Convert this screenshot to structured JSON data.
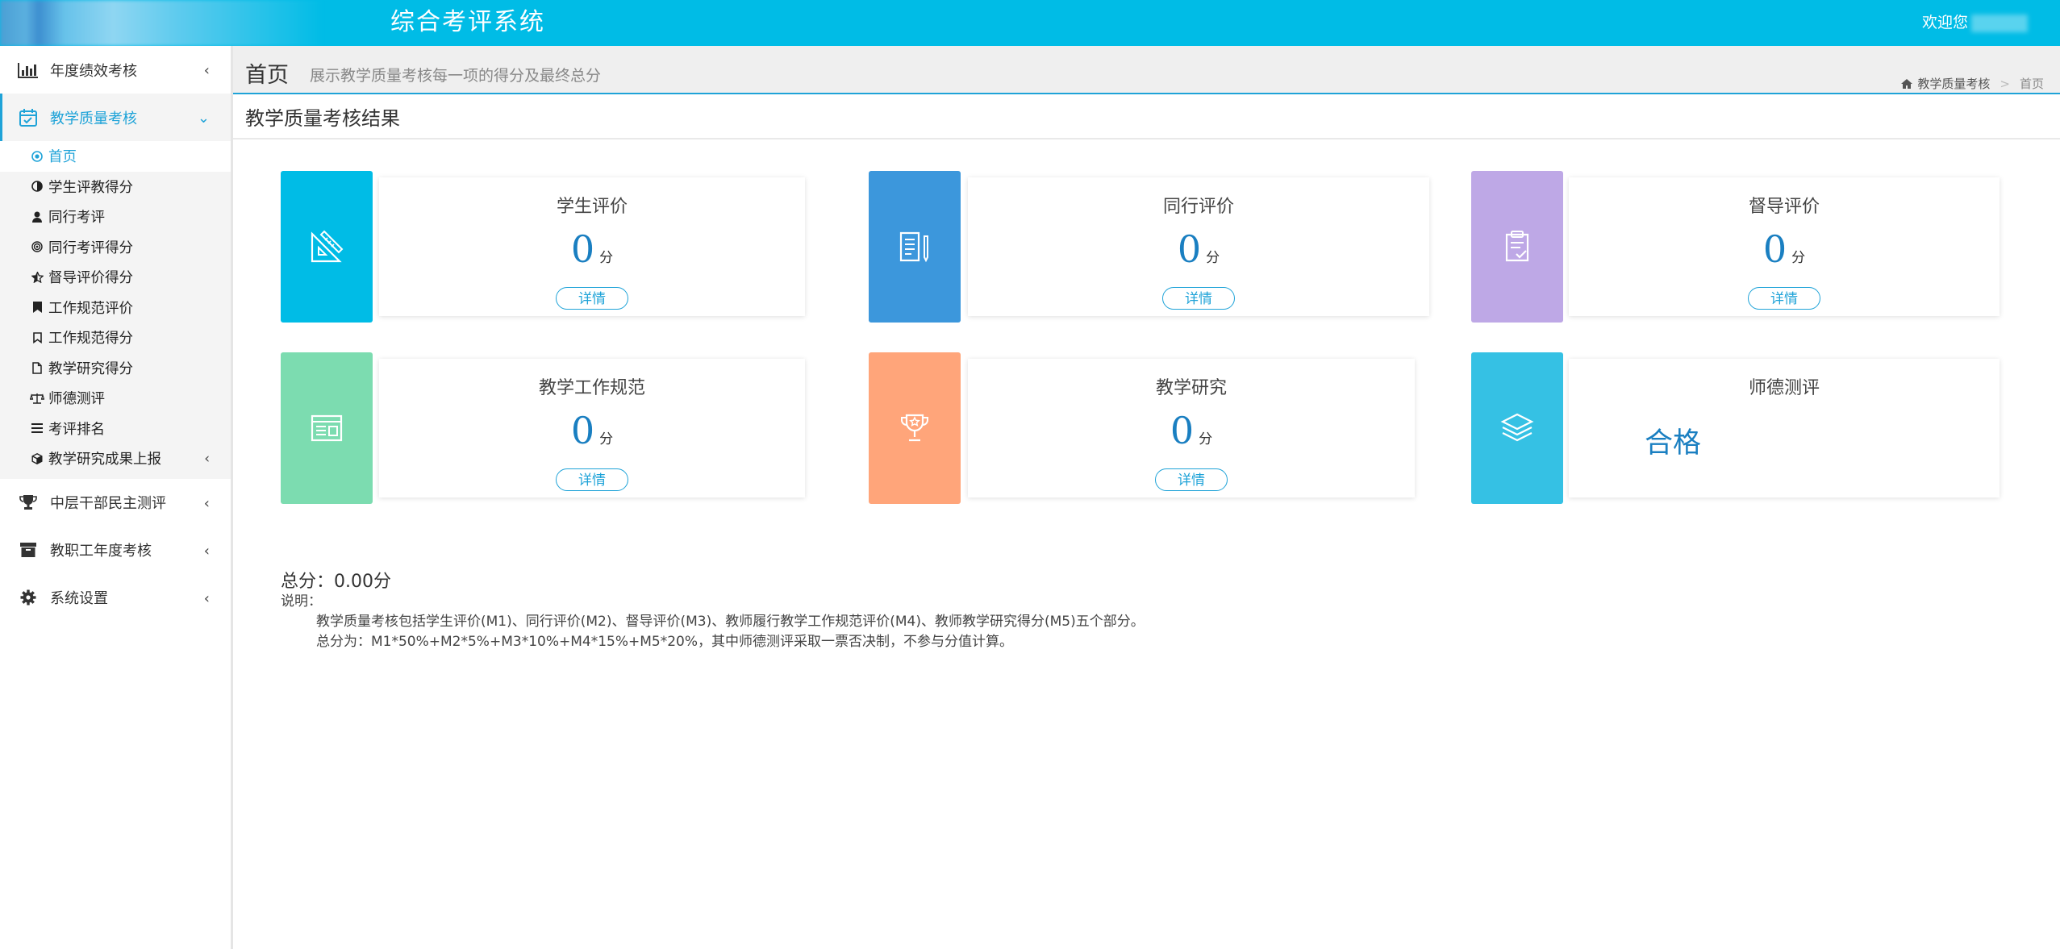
{
  "header": {
    "title": "综合考评系统",
    "welcome": "欢迎您"
  },
  "sidebar": {
    "items": [
      {
        "label": "年度绩效考核",
        "icon": "bar-chart-icon"
      },
      {
        "label": "教学质量考核",
        "icon": "calendar-check-icon",
        "active": true,
        "children": [
          {
            "label": "首页",
            "icon": "dot-circle-icon",
            "active": true
          },
          {
            "label": "学生评教得分",
            "icon": "half-circle-icon"
          },
          {
            "label": "同行考评",
            "icon": "user-icon"
          },
          {
            "label": "同行考评得分",
            "icon": "bullseye-icon"
          },
          {
            "label": "督导评价得分",
            "icon": "star-half-icon"
          },
          {
            "label": "工作规范评价",
            "icon": "bookmark-icon"
          },
          {
            "label": "工作规范得分",
            "icon": "bookmark-outline-icon"
          },
          {
            "label": "教学研究得分",
            "icon": "file-icon"
          },
          {
            "label": "师德测评",
            "icon": "balance-scale-icon"
          },
          {
            "label": "考评排名",
            "icon": "list-icon"
          },
          {
            "label": "教学研究成果上报",
            "icon": "cube-icon"
          }
        ]
      },
      {
        "label": "中层干部民主测评",
        "icon": "trophy-icon"
      },
      {
        "label": "教职工年度考核",
        "icon": "archive-icon"
      },
      {
        "label": "系统设置",
        "icon": "gear-icon"
      }
    ]
  },
  "page": {
    "title": "首页",
    "subtitle": "展示教学质量考核每一项的得分及最终总分",
    "breadcrumb": {
      "parent": "教学质量考核",
      "current": "首页"
    },
    "section_title": "教学质量考核结果"
  },
  "cards": [
    {
      "title": "学生评价",
      "score": "0",
      "unit": "分",
      "button": "详情",
      "color": "#00bce6",
      "icon": "ruler-triangle-icon"
    },
    {
      "title": "同行评价",
      "score": "0",
      "unit": "分",
      "button": "详情",
      "color": "#3c97dc",
      "icon": "document-pen-icon"
    },
    {
      "title": "督导评价",
      "score": "0",
      "unit": "分",
      "button": "详情",
      "color": "#bea8e6",
      "icon": "clipboard-check-icon"
    },
    {
      "title": "教学工作规范",
      "score": "0",
      "unit": "分",
      "button": "详情",
      "color": "#7cdcb0",
      "icon": "browser-window-icon"
    },
    {
      "title": "教学研究",
      "score": "0",
      "unit": "分",
      "button": "详情",
      "color": "#ffa57a",
      "icon": "trophy-star-icon"
    },
    {
      "title": "师德测评",
      "result": "合格",
      "color": "#35c1e4",
      "icon": "layers-icon"
    }
  ],
  "summary": {
    "total": "总分：0.00分",
    "notes_label": "说明：",
    "note1": "教学质量考核包括学生评价(M1)、同行评价(M2)、督导评价(M3)、教师履行教学工作规范评价(M4)、教师教学研究得分(M5)五个部分。",
    "note2": "总分为：M1*50%+M2*5%+M3*10%+M4*15%+M5*20%，其中师德测评采取一票否决制，不参与分值计算。"
  }
}
